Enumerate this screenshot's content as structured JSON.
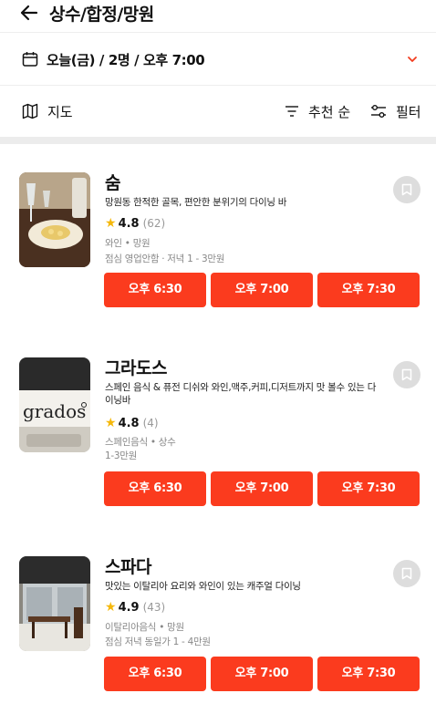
{
  "header": {
    "title": "상수/합정/망원",
    "back_icon": "arrow-left-icon"
  },
  "search": {
    "date_summary": "오늘(금) / 2명 / 오후 7:00",
    "accent": "#f23c1e"
  },
  "toolbar": {
    "map_label": "지도",
    "sort_label": "추천 순",
    "filter_label": "필터"
  },
  "restaurants": [
    {
      "name": "숨",
      "description": "망원동 한적한 골목, 편안한 분위기의 다이닝 바",
      "rating": "4.8",
      "reviews": "(62)",
      "cuisine": "와인 • 망원",
      "hours": "점심 영업안함 · 저녁 1 - 3만원",
      "slots": [
        "오후 6:30",
        "오후 7:00",
        "오후 7:30"
      ]
    },
    {
      "name": "그라도스",
      "description": "스페인 음식 & 퓨전 디쉬와 와인,맥주,커피,디저트까지 맛 볼수 있는 다이닝바",
      "rating": "4.8",
      "reviews": "(4)",
      "cuisine": "스페인음식 • 상수",
      "hours": "1-3만원",
      "thumb_text": "grados",
      "slots": [
        "오후 6:30",
        "오후 7:00",
        "오후 7:30"
      ]
    },
    {
      "name": "스파다",
      "description": "맛있는 이탈리아 요리와 와인이 있는 캐주얼 다이닝",
      "rating": "4.9",
      "reviews": "(43)",
      "cuisine": "이탈리아음식 • 망원",
      "hours": "점심 저녁 동일가 1 - 4만원",
      "slots": [
        "오후 6:30",
        "오후 7:00",
        "오후 7:30"
      ]
    }
  ]
}
